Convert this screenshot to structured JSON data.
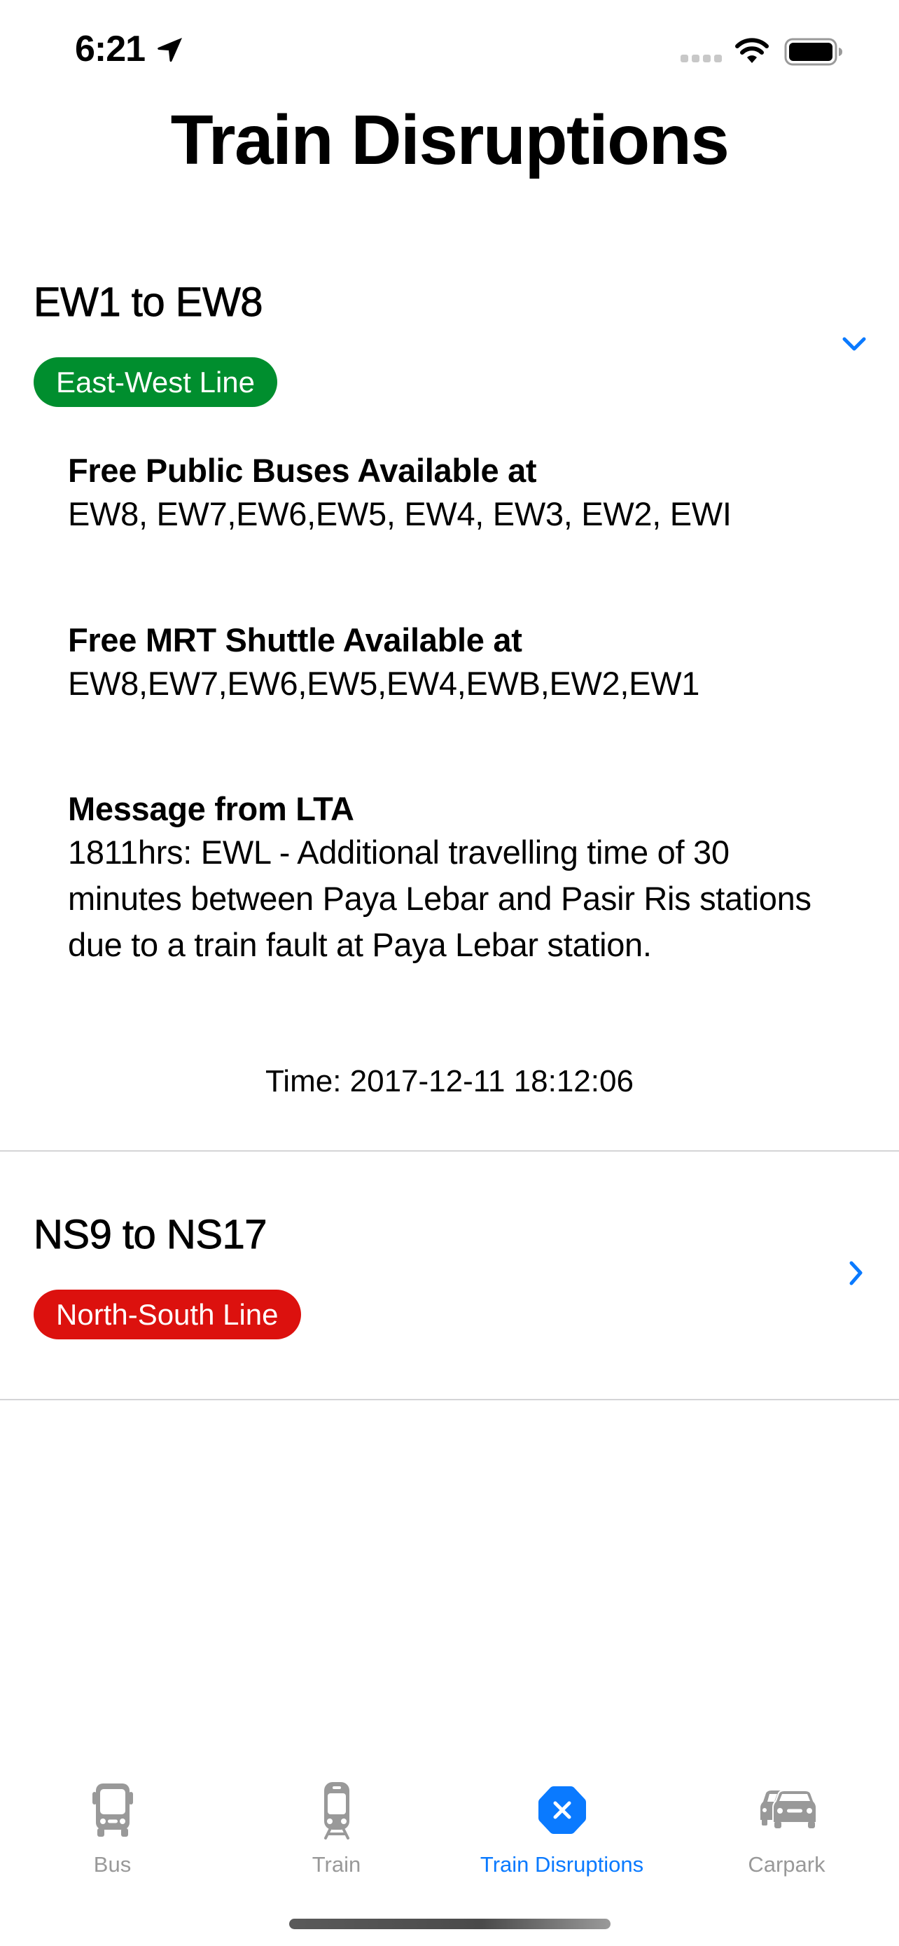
{
  "status_bar": {
    "time": "6:21",
    "location_icon": "location-arrow-icon",
    "signal_icon": "cellular-signal-icon",
    "wifi_icon": "wifi-icon",
    "battery_icon": "battery-full-icon"
  },
  "header": {
    "title": "Train Disruptions"
  },
  "disruptions": [
    {
      "heading": "EW1 to EW8",
      "line": "East-West Line",
      "line_color": "#008e2e",
      "expanded": true,
      "chevron_icon": "chevron-down-icon",
      "details": [
        {
          "label": "Free Public Buses Available at",
          "value": "EW8, EW7,EW6,EW5, EW4, EW3, EW2, EWI"
        },
        {
          "label": "Free MRT Shuttle Available at",
          "value": "EW8,EW7,EW6,EW5,EW4,EWB,EW2,EW1"
        },
        {
          "label": "Message from LTA",
          "value": "1811hrs: EWL - Additional travelling time of 30 minutes between Paya Lebar and Pasir Ris stations due to a train fault at Paya Lebar station."
        }
      ],
      "time": "Time: 2017-12-11 18:12:06"
    },
    {
      "heading": "NS9 to NS17",
      "line": "North-South Line",
      "line_color": "#dc110e",
      "expanded": false,
      "chevron_icon": "chevron-right-icon"
    }
  ],
  "tab_bar": {
    "accent_color": "#0a7aff",
    "inactive_color": "#999999",
    "tabs": [
      {
        "label": "Bus",
        "icon": "bus-icon",
        "active": false
      },
      {
        "label": "Train",
        "icon": "train-icon",
        "active": false
      },
      {
        "label": "Train Disruptions",
        "icon": "xmark-octagon-icon",
        "active": true
      },
      {
        "label": "Carpark",
        "icon": "cars-icon",
        "active": false
      }
    ]
  }
}
